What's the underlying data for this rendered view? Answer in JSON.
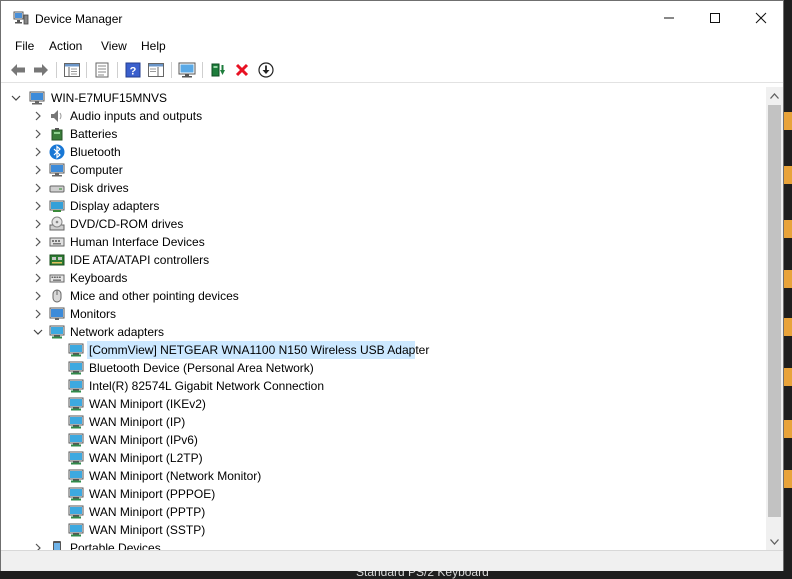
{
  "window": {
    "title": "Device Manager"
  },
  "menu": [
    "File",
    "Action",
    "View",
    "Help"
  ],
  "tree": {
    "root": "WIN-E7MUF15MNVS",
    "categories": [
      "Audio inputs and outputs",
      "Batteries",
      "Bluetooth",
      "Computer",
      "Disk drives",
      "Display adapters",
      "DVD/CD-ROM drives",
      "Human Interface Devices",
      "IDE ATA/ATAPI controllers",
      "Keyboards",
      "Mice and other pointing devices",
      "Monitors",
      "Network adapters"
    ],
    "network_adapters": [
      "[CommView] NETGEAR WNA1100 N150 Wireless USB Adapter",
      "Bluetooth Device (Personal Area Network)",
      "Intel(R) 82574L Gigabit Network Connection",
      "WAN Miniport (IKEv2)",
      "WAN Miniport (IP)",
      "WAN Miniport (IPv6)",
      "WAN Miniport (L2TP)",
      "WAN Miniport (Network Monitor)",
      "WAN Miniport (PPPOE)",
      "WAN Miniport (PPTP)",
      "WAN Miniport (SSTP)"
    ],
    "selected_adapter": "[CommView] NETGEAR WNA1100 N150 Wireless USB Adapter",
    "partial_category": "Portable Devices"
  },
  "background": {
    "taskbar_text": "Standard PS/2 Keyboard"
  },
  "colors": {
    "selection": "#cce8ff",
    "accent": "#0078d7",
    "remove": "#e81123"
  }
}
